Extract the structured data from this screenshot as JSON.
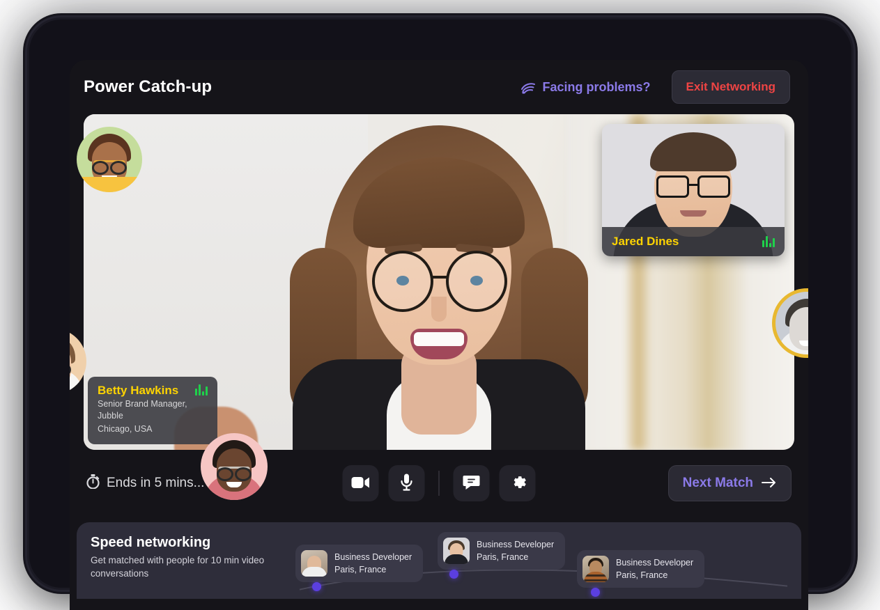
{
  "header": {
    "title": "Power Catch-up",
    "help_label": "Facing problems?",
    "help_icon": "wifi-icon",
    "exit_label": "Exit Networking",
    "help_color": "#8b7ae8",
    "exit_color": "#ef4444"
  },
  "stage": {
    "participant": {
      "name": "Betty Hawkins",
      "role": "Senior Brand Manager, Jubble",
      "location": "Chicago, USA",
      "name_color": "#fdd302",
      "audio_icon": "audio-wave-icon"
    },
    "pip": {
      "name": "Jared Dines",
      "name_color": "#fdd302",
      "audio_icon": "audio-wave-icon"
    },
    "floating_avatars": [
      {
        "name": "avatar-top-left",
        "ring_color": "#f7c33f",
        "bg_color": "#c5dd9c"
      },
      {
        "name": "avatar-left",
        "bg_color": "#f0d0ab"
      },
      {
        "name": "avatar-right",
        "ring_color": "#e8b830",
        "badge": "👋"
      },
      {
        "name": "avatar-bottom",
        "bg_color": "#f6c6c4"
      }
    ]
  },
  "controls": {
    "timer_text": "Ends in 5 mins...",
    "timer_icon": "stopwatch-icon",
    "buttons": [
      {
        "name": "camera-button",
        "icon": "video-camera-icon"
      },
      {
        "name": "microphone-button",
        "icon": "microphone-icon"
      },
      {
        "name": "chat-button",
        "icon": "chat-bubble-icon"
      },
      {
        "name": "settings-button",
        "icon": "gear-icon"
      }
    ],
    "next_match_label": "Next Match",
    "next_match_icon": "arrow-right-icon",
    "next_match_color": "#8b7ae8"
  },
  "speed_networking": {
    "title": "Speed networking",
    "subtitle": "Get matched with people for 10 min video conversations",
    "accent_color": "#5b3fe0",
    "cards": [
      {
        "role": "Business Developer",
        "location": "Paris, France"
      },
      {
        "role": "Business Developer",
        "location": "Paris, France"
      },
      {
        "role": "Business Developer",
        "location": "Paris, France"
      }
    ]
  }
}
